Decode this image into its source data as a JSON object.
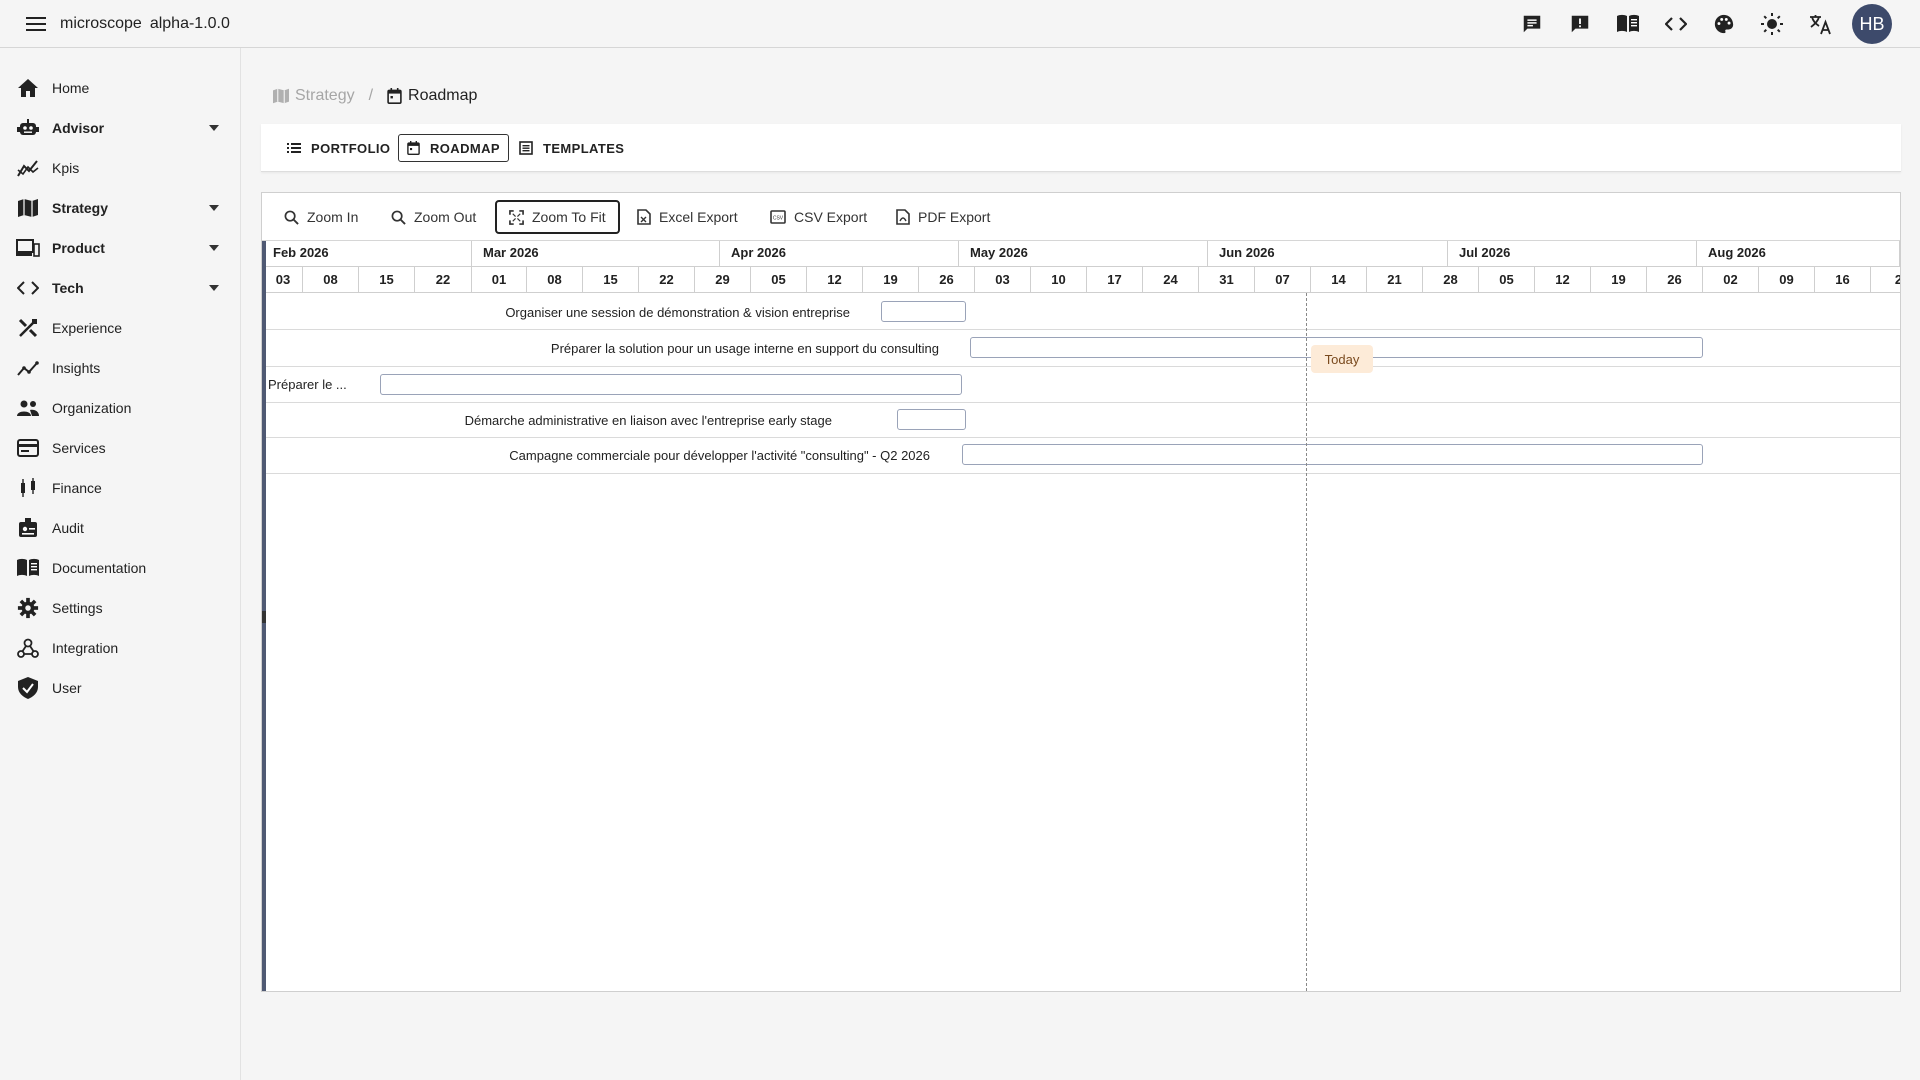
{
  "app": {
    "title": "microscope",
    "version": "alpha-1.0.0",
    "user_initials": "HB",
    "header_icons": [
      "chat-icon",
      "feedback-icon",
      "docs-book-icon",
      "code-icon",
      "palette-icon",
      "brightness-icon",
      "translate-icon"
    ]
  },
  "sidebar": {
    "items": [
      {
        "label": "Home",
        "icon": "home-icon",
        "expandable": false
      },
      {
        "label": "Advisor",
        "icon": "robot-icon",
        "expandable": true
      },
      {
        "label": "Kpis",
        "icon": "kpi-chart-icon",
        "expandable": false
      },
      {
        "label": "Strategy",
        "icon": "map-icon",
        "expandable": true
      },
      {
        "label": "Product",
        "icon": "devices-icon",
        "expandable": true
      },
      {
        "label": "Tech",
        "icon": "code-icon",
        "expandable": true
      },
      {
        "label": "Experience",
        "icon": "design-icon",
        "expandable": false
      },
      {
        "label": "Insights",
        "icon": "insights-icon",
        "expandable": false
      },
      {
        "label": "Organization",
        "icon": "people-icon",
        "expandable": false
      },
      {
        "label": "Services",
        "icon": "services-icon",
        "expandable": false
      },
      {
        "label": "Finance",
        "icon": "candlestick-icon",
        "expandable": false
      },
      {
        "label": "Audit",
        "icon": "audit-badge-icon",
        "expandable": false
      },
      {
        "label": "Documentation",
        "icon": "book-icon",
        "expandable": false
      },
      {
        "label": "Settings",
        "icon": "gear-icon",
        "expandable": false
      },
      {
        "label": "Integration",
        "icon": "webhook-icon",
        "expandable": false
      },
      {
        "label": "User",
        "icon": "shield-check-icon",
        "expandable": false
      }
    ]
  },
  "breadcrumb": {
    "parent": "Strategy",
    "separator": "/",
    "current": "Roadmap"
  },
  "tabs": [
    {
      "label": "PORTFOLIO",
      "icon": "list-icon",
      "active": false
    },
    {
      "label": "ROADMAP",
      "icon": "calendar-icon",
      "active": true
    },
    {
      "label": "TEMPLATES",
      "icon": "table-icon",
      "active": false
    }
  ],
  "toolbar": [
    {
      "label": "Zoom In",
      "icon": "zoom-in-icon"
    },
    {
      "label": "Zoom Out",
      "icon": "zoom-out-icon"
    },
    {
      "label": "Zoom To Fit",
      "icon": "fit-screen-icon"
    },
    {
      "label": "Excel Export",
      "icon": "excel-file-icon"
    },
    {
      "label": "CSV Export",
      "icon": "csv-icon"
    },
    {
      "label": "PDF Export",
      "icon": "pdf-file-icon"
    }
  ],
  "timeline": {
    "months": [
      "Feb 2026",
      "Mar 2026",
      "Apr 2026",
      "May 2026",
      "Jun 2026",
      "Jul 2026",
      "Aug 2026"
    ],
    "weeks": [
      "03",
      "08",
      "15",
      "22",
      "01",
      "08",
      "15",
      "22",
      "29",
      "05",
      "12",
      "19",
      "26",
      "03",
      "10",
      "17",
      "24",
      "31",
      "07",
      "14",
      "21",
      "28",
      "05",
      "12",
      "19",
      "26",
      "02",
      "09",
      "16",
      "2"
    ],
    "today_label": "Today"
  },
  "tasks": [
    {
      "name": "Organiser une session de démonstration & vision entreprise"
    },
    {
      "name": "Préparer la solution pour un usage interne en support du consulting"
    },
    {
      "name": "Préparer le ..."
    },
    {
      "name": "Démarche administrative en liaison avec l'entreprise early stage"
    },
    {
      "name": "Campagne commerciale pour développer l'activité \"consulting\" - Q2 2026"
    }
  ]
}
